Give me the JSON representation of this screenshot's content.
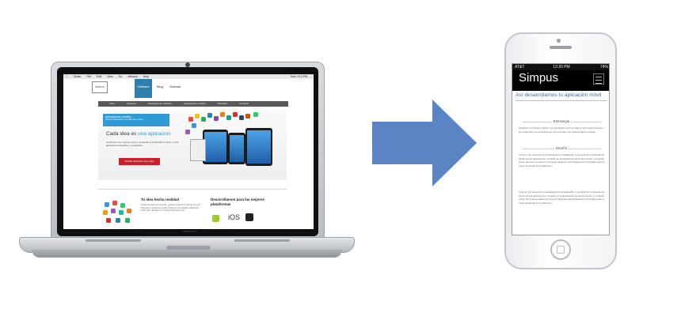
{
  "laptop": {
    "menubar": [
      "Finder",
      "File",
      "Edit",
      "View",
      "Go",
      "Window",
      "Help"
    ],
    "menubar_right": "Mon 4:12 PM",
    "logo_text": "SIMPUS",
    "nav_active": "Software",
    "nav_items": [
      "Blog",
      "Noticias"
    ],
    "subnav": [
      "Inicio",
      "Nosotros",
      "Desarrollo de software",
      "Aplicaciones móviles",
      "Tutoriales",
      "Contacto"
    ],
    "hero_tab_title": "Aplicaciones móviles",
    "hero_tab_sub": "Toda la información a un click de tu mano",
    "hero_title_plain": "Cada idea es ",
    "hero_title_accent": "una aplicación",
    "hero_body": "Contamos con expertos que te ayudarán a desarrollar tu idea y crear aplicaciones flexibles y escalables.",
    "hero_button": "Solicita cotización de tu app",
    "section1_title": "Tu idea hecha realidad",
    "section1_body": "Todas las ideas son buenas, ¿porqué privar al mundo de la tuya? Nosotros te podemos ayudar a hacerla una realidad, platicanos sobre ella y llevaremos tu idea al siguiente nivel.",
    "section2_title": "Desarrollamos para las mejores plataformas",
    "section2_ios": "iOS",
    "model_label": "MacBook Pro"
  },
  "phone": {
    "carrier": "AT&T",
    "time": "12:20 PM",
    "battery": "74%",
    "brand": "Simpus",
    "headline": "Así desarrollamos tu aplicación móvil",
    "section1_title": "Estrategia",
    "section1_body": "Ayudamos al cliente a definir una estrategia móvil en base a sus requerimientos y las tendencias en tecnología que nos permitan una implementación exitosa.",
    "section2_title": "Diseño",
    "section2_body_a": "Una vez que tenemos una estrategia bien establecida, en general las propuestas de diseño de las aplicaciones. Consiste en la arquitectura de la información y el diseño visual. Se renueve desde el concepto hasta las especificaciones funcionales para el mejor desarrollo de la aplicación.",
    "section2_body_b": "Una vez que tenemos una estrategia bien establecida, en general las propuestas de diseño de las aplicaciones. Consiste en la arquitectura de la información y el diseño visual. Se renueve desde el concepto hasta las especificaciones funcionales para el mejor desarrollo de la aplicación."
  },
  "colors": {
    "arrow": "#5b84c4",
    "accent_blue": "#2f9ad6",
    "cta_red": "#c7222a"
  }
}
